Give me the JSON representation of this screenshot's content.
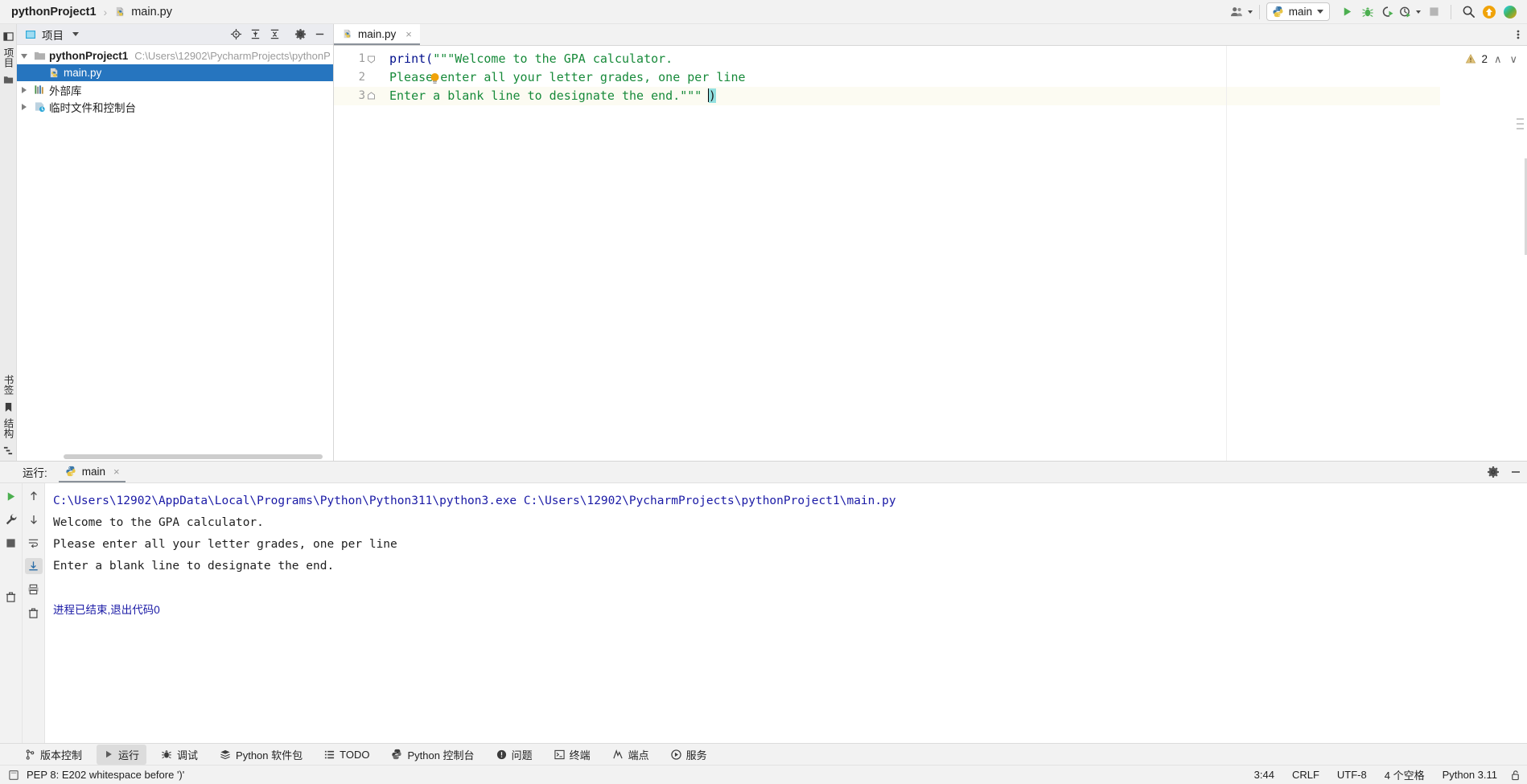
{
  "breadcrumb": {
    "project": "pythonProject1",
    "separator": "›",
    "file": "main.py"
  },
  "toolbar": {
    "account_icon": "people-icon",
    "run_config_label": "main",
    "run_icon": "run-icon",
    "debug_icon": "debug-icon",
    "run_coverage_icon": "run-with-coverage-icon",
    "profile_icon": "profiler-icon",
    "stop_icon": "stop-icon",
    "search_icon": "search-icon",
    "updates_icon": "update-arrow-icon",
    "feedback_icon": "feedback-icon"
  },
  "left_strip": {
    "project_label": "项目",
    "folder_icon": "folder-icon",
    "bookmarks_label": "书签",
    "structure_label": "结构"
  },
  "project_panel": {
    "title": "项目",
    "icons": [
      "locate-icon",
      "expand-all-icon",
      "collapse-all-icon",
      "settings-gear-icon",
      "hide-icon"
    ],
    "tree": [
      {
        "label": "pythonProject1",
        "path": "C:\\Users\\12902\\PycharmProjects\\pythonP",
        "icon": "folder-icon",
        "expanded": true,
        "selected": false,
        "indent": 0
      },
      {
        "label": "main.py",
        "path": "",
        "icon": "python-file-icon",
        "expanded": null,
        "selected": true,
        "indent": 1
      },
      {
        "label": "外部库",
        "path": "",
        "icon": "library-icon",
        "expanded": false,
        "selected": false,
        "indent": 0
      },
      {
        "label": "临时文件和控制台",
        "path": "",
        "icon": "scratches-icon",
        "expanded": false,
        "selected": false,
        "indent": 0
      }
    ]
  },
  "editor": {
    "tab_label": "main.py",
    "tab_icon": "python-file-icon",
    "tab_close": "×",
    "more_icon": "vertical-dots-icon",
    "line_numbers": [
      "1",
      "2",
      "3"
    ],
    "lines": [
      {
        "number": "1",
        "tokens": [
          {
            "t": "print",
            "k": "kw"
          },
          {
            "t": "(",
            "k": "kw"
          },
          {
            "t": "\"\"\"Welcome to the GPA calculator.",
            "k": "str"
          }
        ]
      },
      {
        "number": "2",
        "tokens": [
          {
            "t": "Please enter all your letter grades, one per line",
            "k": "str"
          }
        ]
      },
      {
        "number": "3",
        "tokens": [
          {
            "t": "Enter a blank line to designate the end.\"\"\" ",
            "k": "str"
          },
          {
            "t": ")",
            "k": "paren"
          }
        ]
      }
    ],
    "warning_count": "2",
    "warning_icon": "warning-triangle-icon",
    "prev_icon": "∧",
    "next_icon": "∨",
    "bulb_icon": "intention-bulb-icon"
  },
  "run_panel": {
    "label": "运行:",
    "tab_label": "main",
    "tab_icon": "python-icon",
    "tab_close": "×",
    "settings_icon": "settings-gear-icon",
    "minimize_icon": "minimize-icon",
    "tools_left": [
      "rerun-icon",
      "wrench-icon",
      "stop-icon",
      "trash-icon"
    ],
    "tools_mid": [
      "scroll-up-icon",
      "scroll-down-icon",
      "soft-wrap-icon",
      "scroll-to-end-icon",
      "print-icon",
      "clear-icon"
    ],
    "console": [
      {
        "text": "C:\\Users\\12902\\AppData\\Local\\Programs\\Python\\Python311\\python3.exe C:\\Users\\12902\\PycharmProjects\\pythonProject1\\main.py",
        "kind": "cmd"
      },
      {
        "text": "Welcome to the GPA calculator.",
        "kind": "out"
      },
      {
        "text": "Please enter all your letter grades, one per line",
        "kind": "out"
      },
      {
        "text": "Enter a blank line to designate the end.",
        "kind": "out"
      },
      {
        "text": "",
        "kind": "out"
      },
      {
        "text": "进程已结束,退出代码0",
        "kind": "exit"
      }
    ]
  },
  "bottom_tools": [
    {
      "label": "版本控制",
      "icon": "branch-icon",
      "active": false
    },
    {
      "label": "运行",
      "icon": "run-icon",
      "active": true
    },
    {
      "label": "调试",
      "icon": "debug-icon",
      "active": false
    },
    {
      "label": "Python 软件包",
      "icon": "packages-icon",
      "active": false
    },
    {
      "label": "TODO",
      "icon": "todo-icon",
      "active": false
    },
    {
      "label": "Python 控制台",
      "icon": "python-console-icon",
      "active": false
    },
    {
      "label": "问题",
      "icon": "problems-icon",
      "active": false
    },
    {
      "label": "终端",
      "icon": "terminal-icon",
      "active": false
    },
    {
      "label": "端点",
      "icon": "endpoints-icon",
      "active": false
    },
    {
      "label": "服务",
      "icon": "services-icon",
      "active": false
    }
  ],
  "status_bar": {
    "icon": "inspection-icon",
    "message": "PEP 8: E202 whitespace before ')'",
    "caret_position": "3:44",
    "line_separator": "CRLF",
    "encoding": "UTF-8",
    "indent": "4 个空格",
    "interpreter": "Python 3.11",
    "lock_icon": "lock-icon"
  },
  "colors": {
    "accent_blue": "#2675bf",
    "keyword": "#000f8c",
    "string": "#178a3a",
    "console_blue": "#1a1aa6",
    "bracket_highlight": "#93e0e0",
    "current_line": "#fcfbf2"
  }
}
